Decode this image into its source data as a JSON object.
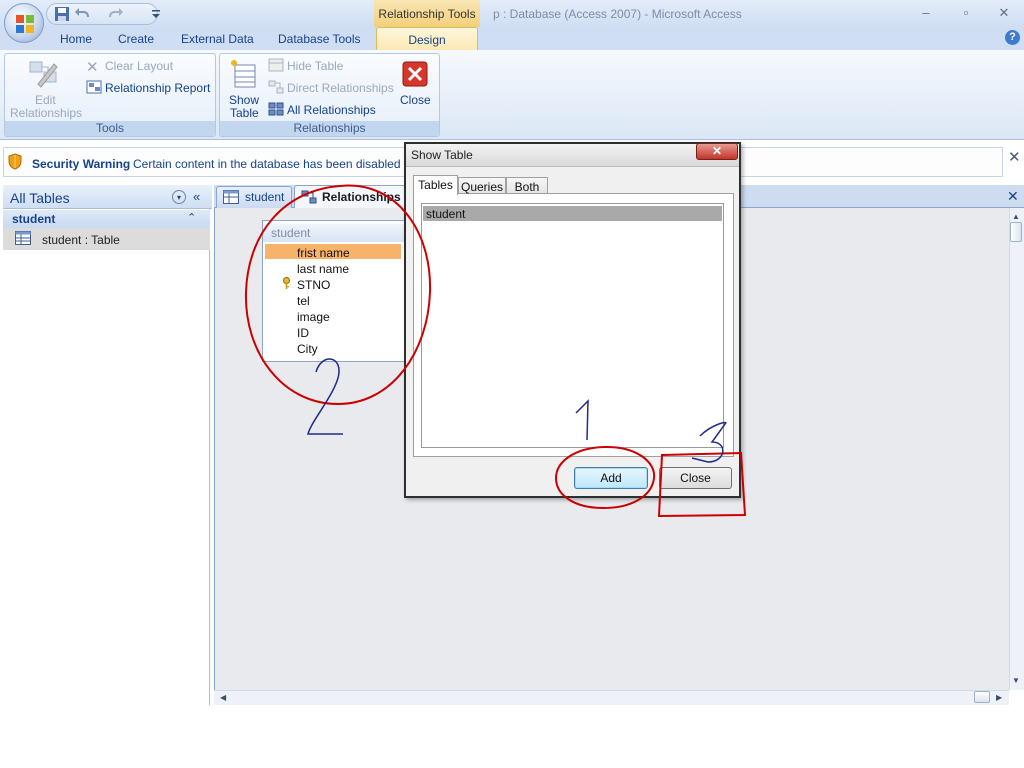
{
  "window": {
    "context_tab_label": "Relationship Tools",
    "title": "p : Database (Access 2007)  -  Microsoft Access",
    "minimize": "–",
    "maximize": "▫",
    "close": "✕"
  },
  "tabs": [
    {
      "label": "Home"
    },
    {
      "label": "Create"
    },
    {
      "label": "External Data"
    },
    {
      "label": "Database Tools"
    },
    {
      "label": "Design"
    }
  ],
  "help": "?",
  "ribbon": {
    "tools_group": {
      "label": "Tools",
      "edit_relationships": "Edit Relationships",
      "edit_relationships_line1": "Edit",
      "edit_relationships_line2": "Relationships",
      "clear_layout": "Clear Layout",
      "relationship_report": "Relationship Report"
    },
    "relationships_group": {
      "label": "Relationships",
      "show_table_line1": "Show",
      "show_table_line2": "Table",
      "hide_table": "Hide Table",
      "direct_relationships": "Direct Relationships",
      "all_relationships": "All Relationships",
      "close": "Close"
    }
  },
  "security": {
    "title": "Security Warning",
    "message": "Certain content in the database has been disabled",
    "close": "✕"
  },
  "nav": {
    "title": "All Tables",
    "dropdown": "▾",
    "collapse": "«",
    "group": "student",
    "group_arrow": "⌃",
    "item": "student : Table"
  },
  "documents": {
    "tabs": [
      {
        "label": "student"
      },
      {
        "label": "Relationships"
      }
    ],
    "close": "✕"
  },
  "field_list": {
    "title": "student",
    "fields": [
      "frist name",
      "last name",
      "STNO",
      "tel",
      "image",
      "ID",
      "City"
    ],
    "primary_key": "STNO"
  },
  "dialog": {
    "title": "Show Table",
    "close": "✕",
    "tabs": [
      "Tables",
      "Queries",
      "Both"
    ],
    "items": [
      "student"
    ],
    "add_button": "Add",
    "close_button": "Close"
  },
  "annotations": {
    "marks": [
      "1",
      "2",
      "3"
    ],
    "color": "#cc0000",
    "ink_color": "#1f2a8a"
  }
}
